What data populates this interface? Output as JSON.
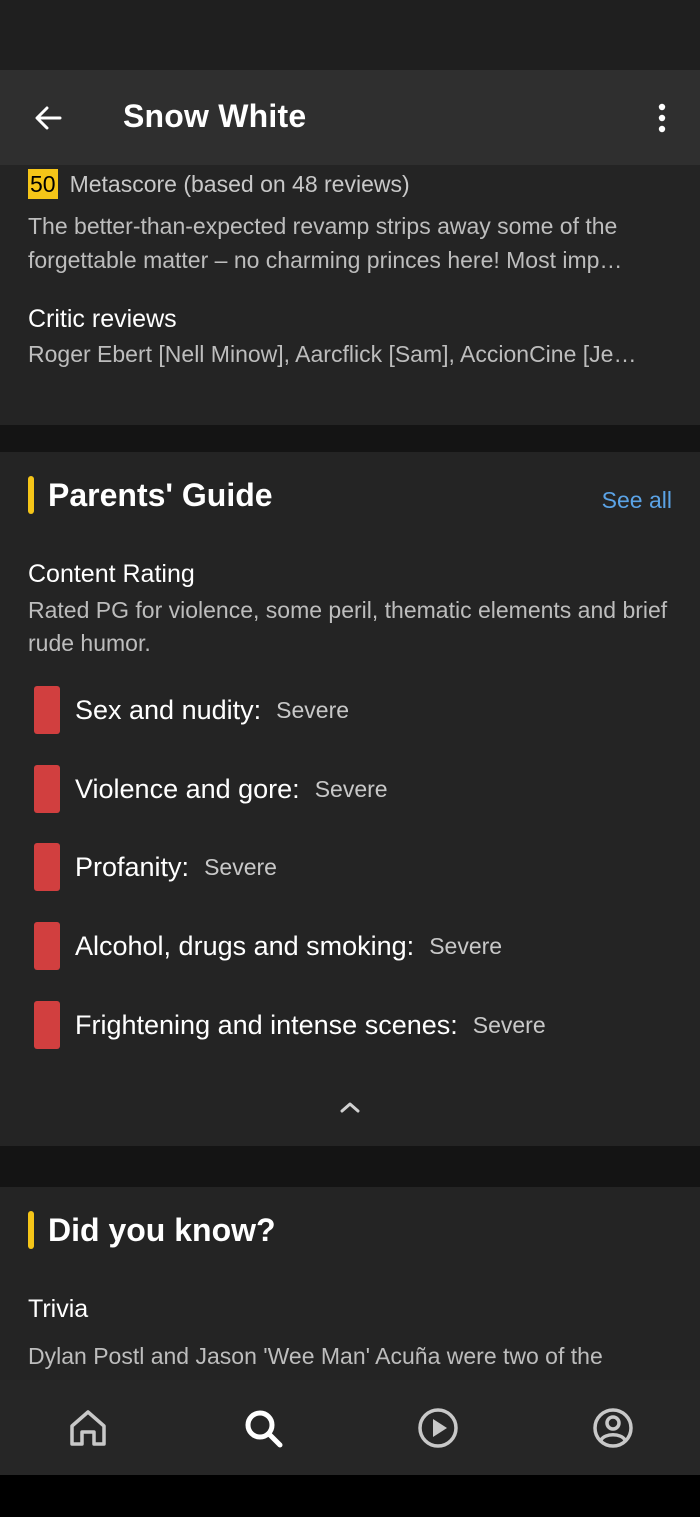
{
  "app_bar": {
    "title": "Snow White"
  },
  "metacritic": {
    "score": "50",
    "label": "Metascore (based on 48 reviews)",
    "quote_line1": "The better-than-expected revamp strips away some of the",
    "quote_line2": "forgettable matter – no charming princes here! Most imp…",
    "critic_reviews_title": "Critic reviews",
    "critic_reviews_list": "Roger Ebert [Nell Minow], Aarcflick [Sam], AccionCine [Je…"
  },
  "parents_guide": {
    "title": "Parents' Guide",
    "see_all": "See all",
    "content_rating_title": "Content Rating",
    "content_rating_desc": "Rated PG for violence, some peril, thematic elements and brief rude humor.",
    "items": [
      {
        "label": "Sex and nudity:",
        "value": "Severe"
      },
      {
        "label": "Violence and gore:",
        "value": "Severe"
      },
      {
        "label": "Profanity:",
        "value": "Severe"
      },
      {
        "label": "Alcohol, drugs and smoking:",
        "value": "Severe"
      },
      {
        "label": "Frightening and intense scenes:",
        "value": "Severe"
      }
    ],
    "severity_color": "#d13f3f"
  },
  "did_you_know": {
    "title": "Did you know?",
    "trivia_title": "Trivia",
    "trivia_text": "Dylan Postl and Jason 'Wee Man' Acuña were two of the"
  },
  "colors": {
    "accent": "#f5c518",
    "link": "#5ba3e6",
    "background": "#1f1f1f"
  },
  "nav": {
    "items": [
      {
        "icon": "home-icon",
        "active": false
      },
      {
        "icon": "search-icon",
        "active": true
      },
      {
        "icon": "play-icon",
        "active": false
      },
      {
        "icon": "profile-icon",
        "active": false
      }
    ]
  }
}
